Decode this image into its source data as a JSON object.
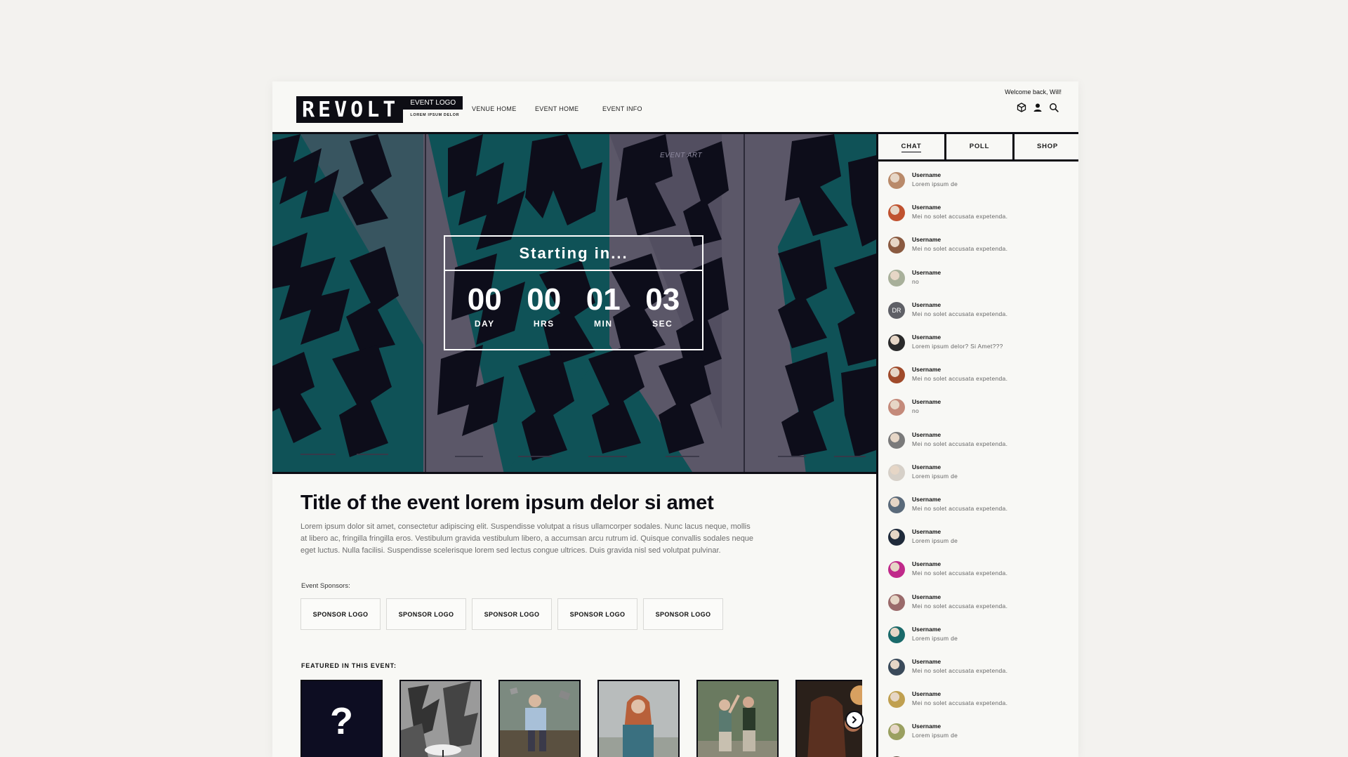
{
  "header": {
    "logo_text": "REVOLT",
    "event_logo_label": "EVENT LOGO",
    "logo_subtitle": "LOREM IPSUM DELOR",
    "nav": [
      "VENUE HOME",
      "EVENT HOME",
      "EVENT INFO"
    ],
    "welcome": "Welcome back, Will!",
    "icons": [
      "cube-icon",
      "user-icon",
      "search-icon"
    ]
  },
  "hero": {
    "art_label": "EVENT ART",
    "countdown_title": "Starting in...",
    "units": [
      {
        "value": "00",
        "label": "DAY"
      },
      {
        "value": "00",
        "label": "HRS"
      },
      {
        "value": "01",
        "label": "MIN"
      },
      {
        "value": "03",
        "label": "SEC"
      }
    ]
  },
  "event": {
    "title": "Title of the event lorem ipsum delor si amet",
    "description": "Lorem ipsum dolor sit amet, consectetur adipiscing elit. Suspendisse volutpat a risus ullamcorper sodales. Nunc lacus neque, mollis at libero ac, fringilla fringilla eros. Vestibulum gravida vestibulum libero, a accumsan arcu rutrum id. Quisque convallis sodales neque eget luctus. Nulla facilisi. Suspendisse scelerisque lorem sed lectus congue ultrices. Duis gravida nisl sed volutpat pulvinar.",
    "sponsors_label": "Event Sponsors:",
    "sponsors": [
      "SPONSOR LOGO",
      "SPONSOR LOGO",
      "SPONSOR LOGO",
      "SPONSOR LOGO",
      "SPONSOR LOGO"
    ],
    "featured_label": "FEATURED IN THIS EVENT:",
    "featured_mystery": "?"
  },
  "sidebar": {
    "tabs": [
      "CHAT",
      "POLL",
      "SHOP"
    ],
    "active_tab": "CHAT",
    "messages": [
      {
        "user": "Username",
        "text": "Lorem ipsum de",
        "color": "#b98a6a"
      },
      {
        "user": "Username",
        "text": "Mei no solet accusata expetenda.",
        "color": "#c0522f"
      },
      {
        "user": "Username",
        "text": "Mei no solet accusata expetenda.",
        "color": "#8a5a40"
      },
      {
        "user": "Username",
        "text": "no",
        "color": "#a8b09a"
      },
      {
        "user": "Username",
        "text": "Mei no solet accusata expetenda.",
        "initials": "DR"
      },
      {
        "user": "Username",
        "text": "Lorem ipsum delor? Si Amet???",
        "color": "#2a2a2a"
      },
      {
        "user": "Username",
        "text": "Mei no solet accusata expetenda.",
        "color": "#a04a2a"
      },
      {
        "user": "Username",
        "text": "no",
        "color": "#c48a7a"
      },
      {
        "user": "Username",
        "text": "Mei no solet accusata expetenda.",
        "color": "#7a7a7a"
      },
      {
        "user": "Username",
        "text": "Lorem ipsum de",
        "color": "#d6d0c8"
      },
      {
        "user": "Username",
        "text": "Mei no solet accusata expetenda.",
        "color": "#5a6a7a"
      },
      {
        "user": "Username",
        "text": "Lorem ipsum de",
        "color": "#1f2a3a"
      },
      {
        "user": "Username",
        "text": "Mei no solet accusata expetenda.",
        "color": "#c02a8a"
      },
      {
        "user": "Username",
        "text": "Mei no solet accusata expetenda.",
        "color": "#9a6a6a"
      },
      {
        "user": "Username",
        "text": "Lorem ipsum de",
        "color": "#1a6a6a"
      },
      {
        "user": "Username",
        "text": "Mei no solet accusata expetenda.",
        "color": "#3a4a5a"
      },
      {
        "user": "Username",
        "text": "Mei no solet accusata expetenda.",
        "color": "#c0a050"
      },
      {
        "user": "Username",
        "text": "Lorem ipsum de",
        "color": "#9aa060"
      },
      {
        "user": "Username",
        "text": "",
        "color": "#5a4a3a"
      }
    ]
  },
  "colors": {
    "ink": "#0d0d14",
    "hero_purple": "#5b5768",
    "hero_teal": "#0f5257",
    "background": "#f3f2ef"
  }
}
